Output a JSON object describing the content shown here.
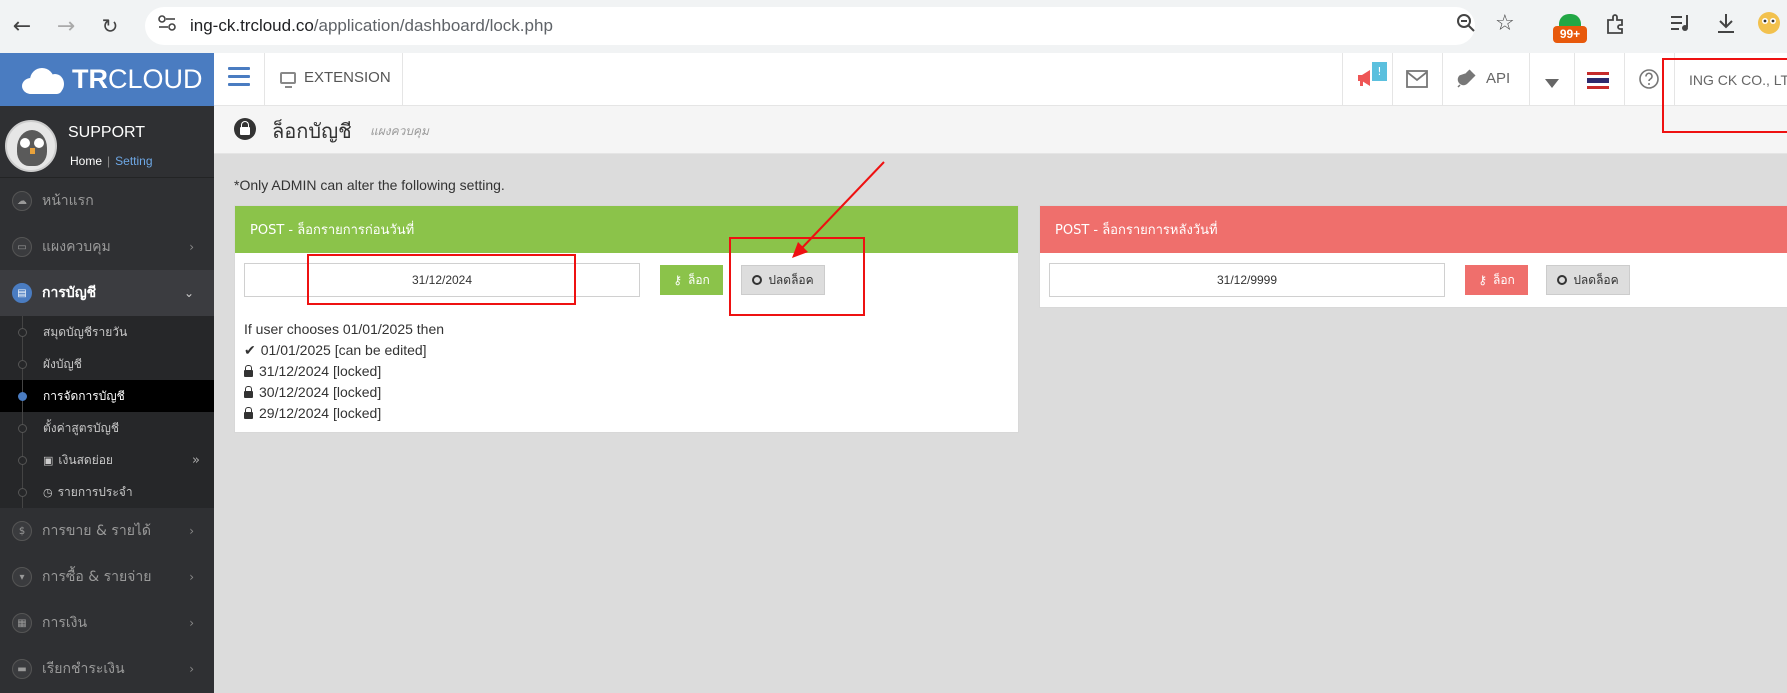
{
  "browser": {
    "url_host": "ing-ck.trcloud.co",
    "url_path": "/application/dashboard/lock.php",
    "ext_badge": "99+"
  },
  "app": {
    "logo_bold": "TR",
    "logo_light": "CLOUD",
    "extension_label": "EXTENSION",
    "notif_count": "!",
    "api_label": "API",
    "company": "ING CK CO., LT"
  },
  "profile": {
    "name": "SUPPORT",
    "home": "Home",
    "setting": "Setting"
  },
  "sidebar": {
    "items": [
      {
        "label": "หน้าแรก"
      },
      {
        "label": "แผงควบคุม"
      },
      {
        "label": "การบัญชี"
      }
    ],
    "subitems": [
      {
        "label": "สมุดบัญชีรายวัน"
      },
      {
        "label": "ผังบัญชี"
      },
      {
        "label": "การจัดการบัญชี"
      },
      {
        "label": "ตั้งค่าสูตรบัญชี"
      },
      {
        "label": "เงินสดย่อย"
      },
      {
        "label": "รายการประจำ"
      }
    ],
    "items2": [
      {
        "label": "การขาย & รายได้"
      },
      {
        "label": "การซื้อ & รายจ่าย"
      },
      {
        "label": "การเงิน"
      },
      {
        "label": "เรียกชำระเงิน"
      }
    ]
  },
  "page": {
    "title": "ล็อกบัญชี",
    "subtitle": "แผงควบคุม",
    "notice": "*Only ADMIN can alter the following setting."
  },
  "panel_before": {
    "title": "POST - ล็อกรายการก่อนวันที่",
    "date": "31/12/2024",
    "lock_label": "ล็อก",
    "unlock_label": "ปลดล็อค",
    "info": [
      "If user chooses 01/01/2025 then",
      "01/01/2025 [can be edited]",
      "31/12/2024 [locked]",
      "30/12/2024 [locked]",
      "29/12/2024 [locked]"
    ]
  },
  "panel_after": {
    "title": "POST - ล็อกรายการหลังวันที่",
    "date": "31/12/9999",
    "lock_label": "ล็อก",
    "unlock_label": "ปลดล็อค"
  }
}
